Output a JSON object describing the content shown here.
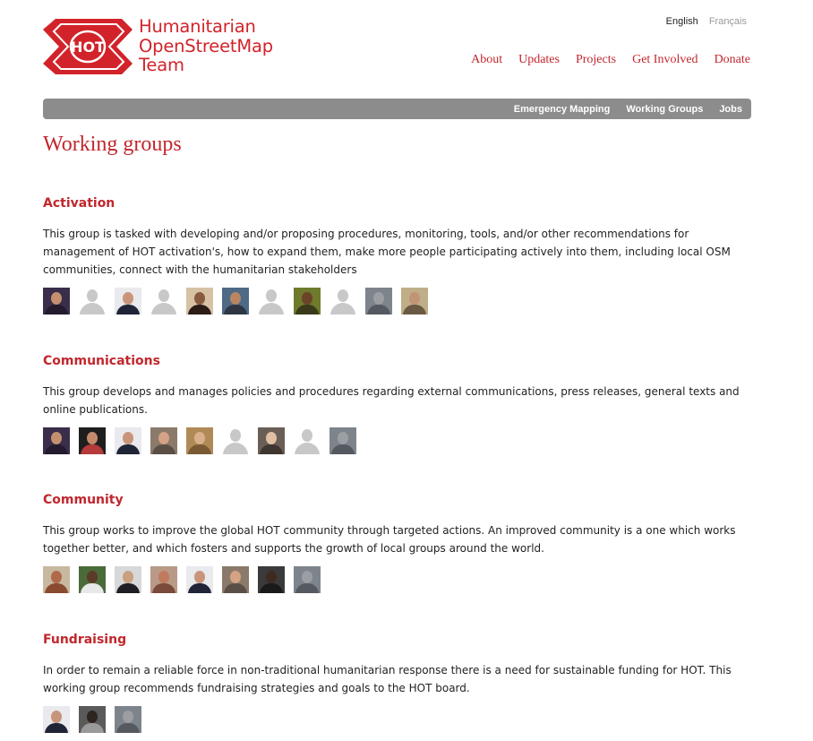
{
  "lang": {
    "english": "English",
    "french": "Français"
  },
  "logo": {
    "mark": "HOT",
    "line1": "Humanitarian",
    "line2": "OpenStreetMap",
    "line3": "Team"
  },
  "mainnav": [
    "About",
    "Updates",
    "Projects",
    "Get Involved",
    "Donate"
  ],
  "subnav": [
    "Emergency Mapping",
    "Working Groups",
    "Jobs"
  ],
  "page_title": "Working groups",
  "colors": {
    "brand_red": "#d2232a",
    "link_red": "#c1272d",
    "subnav_bg": "#8c8c8c",
    "placeholder_gray": "#c8c8c8"
  },
  "groups": [
    {
      "title": "Activation",
      "description": "This group is tasked with developing and/or proposing procedures, monitoring, tools, and/or other recommendations for management of HOT activation's, how to expand them, make more people participating actively into them, including local OSM communities, connect with the humanitarian stakeholders",
      "members": [
        {
          "kind": "photo",
          "bg": "#3a2e4a",
          "face": "#c49070",
          "cloth": "#241b2e"
        },
        {
          "kind": "placeholder"
        },
        {
          "kind": "photo",
          "bg": "#e9e9ee",
          "face": "#c9957a",
          "cloth": "#1f2437"
        },
        {
          "kind": "placeholder"
        },
        {
          "kind": "photo",
          "bg": "#d7c2a6",
          "face": "#8a5a3e",
          "cloth": "#2b1d16"
        },
        {
          "kind": "photo",
          "bg": "#4e6a86",
          "face": "#b98562",
          "cloth": "#2e3644"
        },
        {
          "kind": "placeholder"
        },
        {
          "kind": "photo",
          "bg": "#6e7a2c",
          "face": "#6b4329",
          "cloth": "#3a3a1a"
        },
        {
          "kind": "placeholder"
        },
        {
          "kind": "photo",
          "bg": "#7e848c",
          "face": "#9b9ea3",
          "cloth": "#555a61"
        },
        {
          "kind": "photo",
          "bg": "#bfae88",
          "face": "#c09474",
          "cloth": "#6a5a44"
        }
      ]
    },
    {
      "title": "Communications",
      "description": "This group develops and manages policies and procedures regarding external communications, press releases, general texts and online publications.",
      "members": [
        {
          "kind": "photo",
          "bg": "#3a2e4a",
          "face": "#c49070",
          "cloth": "#241b2e"
        },
        {
          "kind": "photo",
          "bg": "#1e1e1e",
          "face": "#c58a6c",
          "cloth": "#b53a3a"
        },
        {
          "kind": "photo",
          "bg": "#e9e9ee",
          "face": "#c9957a",
          "cloth": "#1f2437"
        },
        {
          "kind": "photo",
          "bg": "#8b7a6a",
          "face": "#d4a285",
          "cloth": "#5a4f46"
        },
        {
          "kind": "photo",
          "bg": "#b08a56",
          "face": "#d9b08c",
          "cloth": "#7a5a34"
        },
        {
          "kind": "placeholder"
        },
        {
          "kind": "photo",
          "bg": "#6a5e56",
          "face": "#e0c0a4",
          "cloth": "#3e3630"
        },
        {
          "kind": "placeholder"
        },
        {
          "kind": "photo",
          "bg": "#7e848c",
          "face": "#9b9ea3",
          "cloth": "#555a61"
        }
      ]
    },
    {
      "title": "Community",
      "description": "This group works to improve the global HOT community through targeted actions. An improved community is a one which works together better, and which fosters and supports the growth of local groups around the world.",
      "members": [
        {
          "kind": "photo",
          "bg": "#c8b8a0",
          "face": "#b06a4a",
          "cloth": "#8a4a30"
        },
        {
          "kind": "photo",
          "bg": "#4a6a3a",
          "face": "#5c3a28",
          "cloth": "#e8e8e8"
        },
        {
          "kind": "photo",
          "bg": "#d8d8d8",
          "face": "#caa080",
          "cloth": "#1e1e24"
        },
        {
          "kind": "photo",
          "bg": "#b89a86",
          "face": "#c07a5e",
          "cloth": "#7a4a3a"
        },
        {
          "kind": "photo",
          "bg": "#e9e9ee",
          "face": "#c9957a",
          "cloth": "#1f2437"
        },
        {
          "kind": "photo",
          "bg": "#8b7a6a",
          "face": "#d4a285",
          "cloth": "#5a4f46"
        },
        {
          "kind": "photo",
          "bg": "#3a3a3a",
          "face": "#3e2a20",
          "cloth": "#1a1a1a"
        },
        {
          "kind": "photo",
          "bg": "#7e848c",
          "face": "#9b9ea3",
          "cloth": "#555a61"
        }
      ]
    },
    {
      "title": "Fundraising",
      "description": "In order to remain a reliable force in non-traditional humanitarian response there is a need for sustainable funding for HOT. This working group recommends fundraising strategies and goals to the HOT board.",
      "members": [
        {
          "kind": "photo",
          "bg": "#e9e9ee",
          "face": "#c9957a",
          "cloth": "#1f2437"
        },
        {
          "kind": "photo",
          "bg": "#5a5a5a",
          "face": "#2e2420",
          "cloth": "#9a9a9a"
        },
        {
          "kind": "photo",
          "bg": "#7e848c",
          "face": "#9b9ea3",
          "cloth": "#555a61"
        }
      ]
    }
  ]
}
